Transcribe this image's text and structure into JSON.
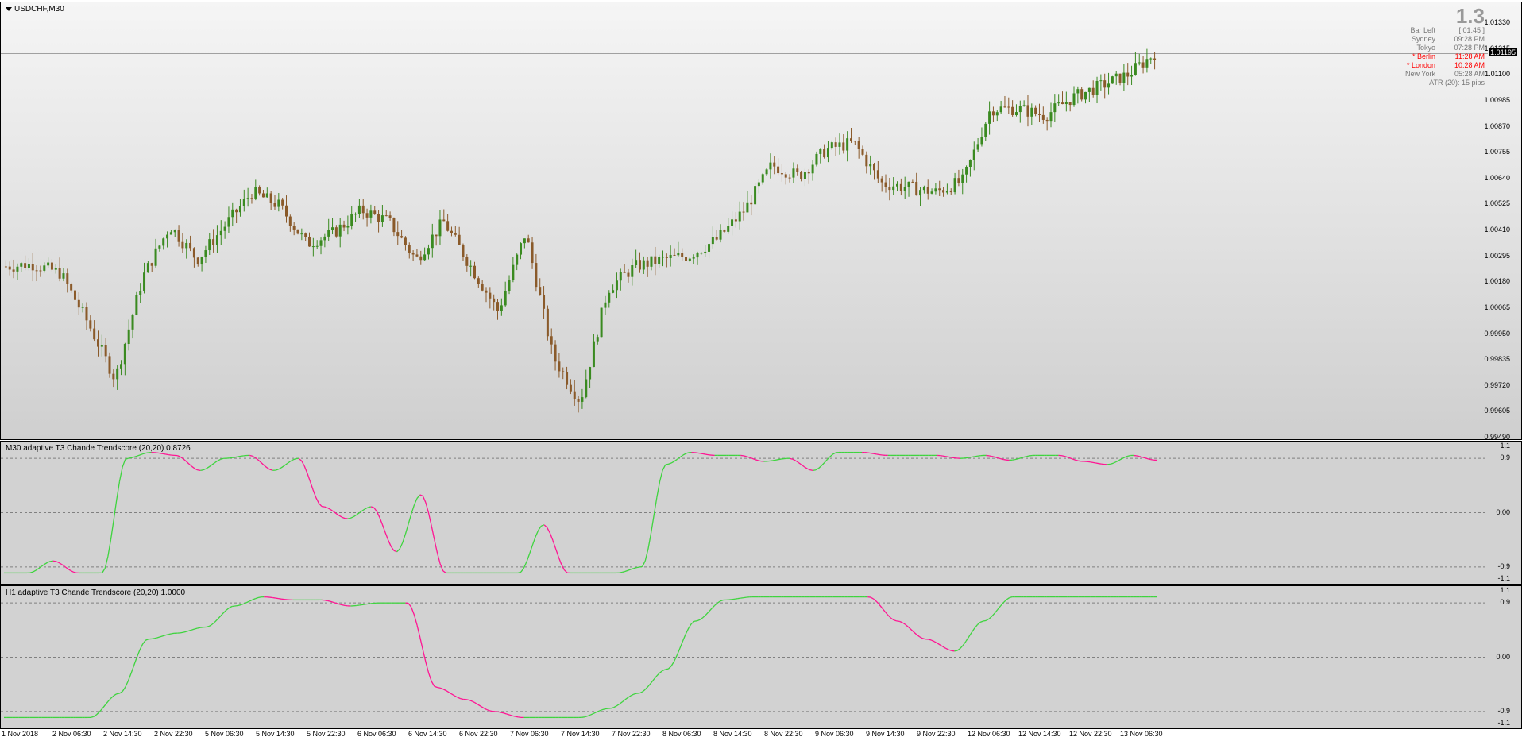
{
  "window": {
    "title": "USDCHF,M30"
  },
  "colors": {
    "bull": "#3a8a20",
    "bear": "#8a5a2a",
    "up_line": "#3ed43e",
    "down_line": "#ff1493"
  },
  "price_axis": {
    "labels": [
      "1.01330",
      "1.01215",
      "1.01100",
      "1.00985",
      "1.00870",
      "1.00755",
      "1.00640",
      "1.00525",
      "1.00410",
      "1.00295",
      "1.00180",
      "1.00065",
      "0.99950",
      "0.99835",
      "0.99720",
      "0.99605",
      "0.99490"
    ],
    "current": "1.01195"
  },
  "info_panel": {
    "big_value": "1.3",
    "rows": [
      {
        "label": "Bar Left",
        "value": "[ 01:45 ]",
        "highlight": false
      },
      {
        "label": "Sydney",
        "value": "09:28 PM",
        "highlight": false
      },
      {
        "label": "Tokyo",
        "value": "07:28 PM",
        "highlight": false
      },
      {
        "label": "* Berlin",
        "value": "11:28 AM",
        "highlight": true
      },
      {
        "label": "* London",
        "value": "10:28 AM",
        "highlight": true
      },
      {
        "label": "New York",
        "value": "05:28 AM",
        "highlight": false
      }
    ],
    "atr": "ATR (20): 15 pips"
  },
  "indicator1": {
    "title": "M30  adaptive T3 Chande Trendscore (20,20) 0.8726",
    "axis": [
      "1.1",
      "0.9",
      "0.00",
      "-0.9",
      "-1.1"
    ]
  },
  "indicator2": {
    "title": "H1  adaptive T3 Chande Trendscore (20,20) 1.0000",
    "axis": [
      "1.1",
      "0.9",
      "0.00",
      "-0.9",
      "-1.1"
    ]
  },
  "time_axis": [
    "1 Nov 2018",
    "2 Nov 06:30",
    "2 Nov 14:30",
    "2 Nov 22:30",
    "5 Nov 06:30",
    "5 Nov 14:30",
    "5 Nov 22:30",
    "6 Nov 06:30",
    "6 Nov 14:30",
    "6 Nov 22:30",
    "7 Nov 06:30",
    "7 Nov 14:30",
    "7 Nov 22:30",
    "8 Nov 06:30",
    "8 Nov 14:30",
    "8 Nov 22:30",
    "9 Nov 06:30",
    "9 Nov 14:30",
    "9 Nov 22:30",
    "12 Nov 06:30",
    "12 Nov 14:30",
    "12 Nov 22:30",
    "13 Nov 06:30"
  ],
  "chart_data": [
    {
      "type": "candlestick",
      "title": "USDCHF,M30",
      "ylim": [
        0.9949,
        1.0138
      ],
      "current_price": 1.01195,
      "x": [
        "1 Nov 2018",
        "2 Nov 06:30",
        "2 Nov 14:30",
        "2 Nov 22:30",
        "5 Nov 06:30",
        "5 Nov 14:30",
        "5 Nov 22:30",
        "6 Nov 06:30",
        "6 Nov 14:30",
        "6 Nov 22:30",
        "7 Nov 06:30",
        "7 Nov 14:30",
        "7 Nov 22:30",
        "8 Nov 06:30",
        "8 Nov 14:30",
        "8 Nov 22:30",
        "9 Nov 06:30",
        "9 Nov 14:30",
        "9 Nov 22:30",
        "12 Nov 06:30",
        "12 Nov 14:30",
        "12 Nov 22:30",
        "13 Nov 06:30"
      ],
      "close_path": [
        1.0025,
        1.0026,
        1.0022,
        1.0,
        0.9975,
        1.002,
        1.0043,
        1.0028,
        1.0043,
        1.0058,
        1.0052,
        1.0035,
        1.004,
        1.005,
        1.0045,
        1.0028,
        1.0045,
        1.0025,
        1.0005,
        1.004,
        0.9985,
        0.9965,
        1.0015,
        1.0025,
        1.0028,
        1.003,
        1.0037,
        1.005,
        1.007,
        1.0065,
        1.0077,
        1.008,
        1.0062,
        1.006,
        1.0058,
        1.0063,
        1.0095,
        1.0095,
        1.0092,
        1.01,
        1.0105,
        1.011,
        1.01195
      ]
    },
    {
      "type": "line",
      "title": "M30  adaptive T3 Chande Trendscore (20,20) 0.8726",
      "ylim": [
        -1.1,
        1.1
      ],
      "x": [
        "1 Nov 2018",
        "2 Nov 06:30",
        "2 Nov 14:30",
        "2 Nov 22:30",
        "5 Nov 06:30",
        "5 Nov 14:30",
        "5 Nov 22:30",
        "6 Nov 06:30",
        "6 Nov 14:30",
        "6 Nov 22:30",
        "7 Nov 06:30",
        "7 Nov 14:30",
        "7 Nov 22:30",
        "8 Nov 06:30",
        "8 Nov 14:30",
        "8 Nov 22:30",
        "9 Nov 06:30",
        "9 Nov 14:30",
        "9 Nov 22:30",
        "12 Nov 06:30",
        "12 Nov 14:30",
        "12 Nov 22:30",
        "13 Nov 06:30"
      ],
      "values": [
        -1.0,
        -1.0,
        -0.8,
        -1.0,
        -1.0,
        0.9,
        1.0,
        0.95,
        0.7,
        0.9,
        0.95,
        0.7,
        0.9,
        0.1,
        -0.1,
        0.1,
        -0.65,
        0.3,
        -1.0,
        -1.0,
        -1.0,
        -1.0,
        -0.2,
        -1.0,
        -1.0,
        -1.0,
        -0.9,
        0.8,
        1.0,
        0.95,
        0.95,
        0.85,
        0.9,
        0.7,
        1.0,
        1.0,
        0.95,
        0.95,
        0.95,
        0.9,
        0.95,
        0.87,
        0.95,
        0.95,
        0.85,
        0.8,
        0.95,
        0.87
      ]
    },
    {
      "type": "line",
      "title": "H1  adaptive T3 Chande Trendscore (20,20) 1.0000",
      "ylim": [
        -1.1,
        1.1
      ],
      "x": [
        "1 Nov 2018",
        "2 Nov 06:30",
        "2 Nov 14:30",
        "2 Nov 22:30",
        "5 Nov 06:30",
        "5 Nov 14:30",
        "5 Nov 22:30",
        "6 Nov 06:30",
        "6 Nov 14:30",
        "6 Nov 22:30",
        "7 Nov 06:30",
        "7 Nov 14:30",
        "7 Nov 22:30",
        "8 Nov 06:30",
        "8 Nov 14:30",
        "8 Nov 22:30",
        "9 Nov 06:30",
        "9 Nov 14:30",
        "9 Nov 22:30",
        "12 Nov 06:30",
        "12 Nov 14:30",
        "12 Nov 22:30",
        "13 Nov 06:30"
      ],
      "values": [
        -1.0,
        -1.0,
        -1.0,
        -1.0,
        -0.6,
        0.3,
        0.4,
        0.5,
        0.85,
        1.0,
        0.95,
        0.95,
        0.85,
        0.9,
        0.9,
        -0.5,
        -0.7,
        -0.9,
        -1.0,
        -1.0,
        -1.0,
        -0.85,
        -0.6,
        -0.2,
        0.6,
        0.95,
        1.0,
        1.0,
        1.0,
        1.0,
        1.0,
        0.6,
        0.3,
        0.1,
        0.6,
        1.0,
        1.0,
        1.0,
        1.0,
        1.0,
        1.0
      ]
    }
  ]
}
